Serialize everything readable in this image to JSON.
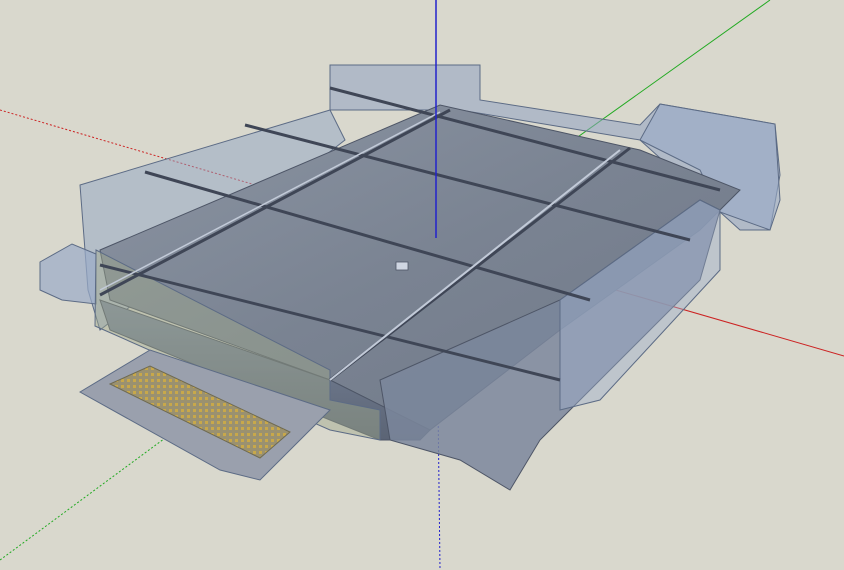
{
  "viewport": {
    "background": "#d9d8cd",
    "axes": {
      "x_color": "#cc2222",
      "y_color": "#22aa22",
      "z_color": "#2222cc"
    }
  },
  "model": {
    "glass_color": "#8fa3c3",
    "roof_color": "#7d8797",
    "beam_color": "#3f4656",
    "vent_color": "#c8a84a"
  }
}
